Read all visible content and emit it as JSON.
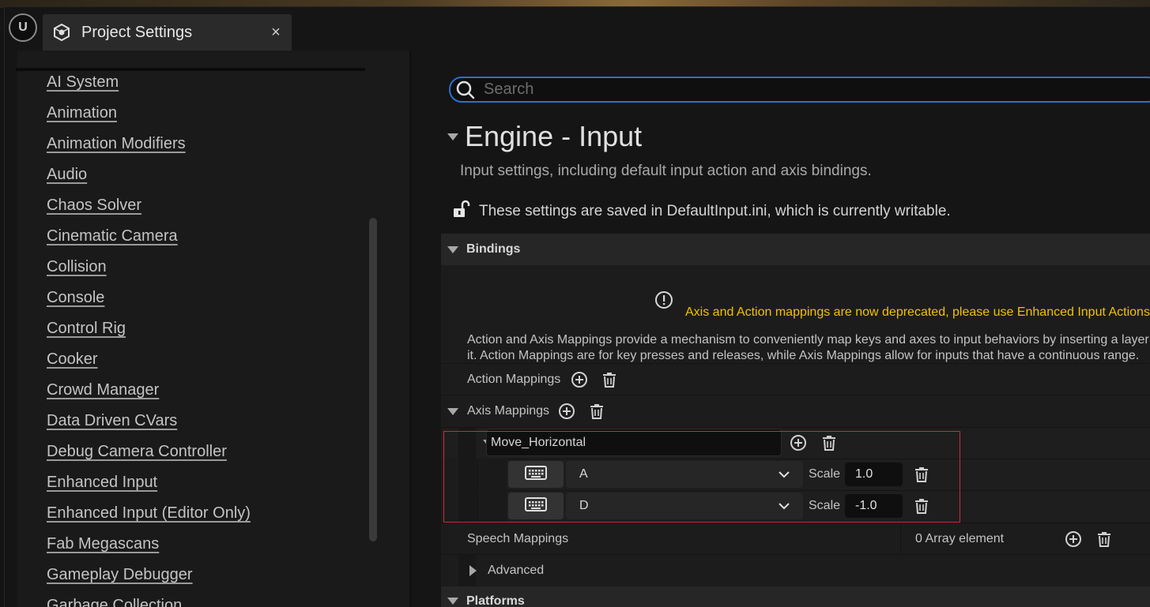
{
  "window": {
    "tab_title": "Project Settings",
    "close_glyph": "×",
    "logo_glyph": "U"
  },
  "sidebar": {
    "items": [
      {
        "label": "AI System"
      },
      {
        "label": "Animation"
      },
      {
        "label": "Animation Modifiers"
      },
      {
        "label": "Audio"
      },
      {
        "label": "Chaos Solver"
      },
      {
        "label": "Cinematic Camera"
      },
      {
        "label": "Collision"
      },
      {
        "label": "Console"
      },
      {
        "label": "Control Rig"
      },
      {
        "label": "Cooker"
      },
      {
        "label": "Crowd Manager"
      },
      {
        "label": "Data Driven CVars"
      },
      {
        "label": "Debug Camera Controller"
      },
      {
        "label": "Enhanced Input"
      },
      {
        "label": "Enhanced Input (Editor Only)"
      },
      {
        "label": "Fab Megascans"
      },
      {
        "label": "Gameplay Debugger"
      },
      {
        "label": "Garbage Collection"
      }
    ]
  },
  "search": {
    "placeholder": "Search",
    "value": ""
  },
  "page": {
    "title": "Engine - Input",
    "description": "Input settings, including default input action and axis bindings.",
    "writable_notice": "These settings are saved in DefaultInput.ini, which is currently writable."
  },
  "bindings": {
    "header": "Bindings",
    "deprecation_warning": "Axis and Action mappings are now deprecated, please use Enhanced Input Actions",
    "description_line1": "Action and Axis Mappings provide a mechanism to conveniently map keys and axes to input behaviors by inserting a layer",
    "description_line2": "it. Action Mappings are for key presses and releases, while Axis Mappings allow for inputs that have a continuous range.",
    "action_mappings_label": "Action Mappings",
    "axis_mappings_label": "Axis Mappings",
    "axis_mapping": {
      "name": "Move_Horizontal",
      "keys": [
        {
          "key": "A",
          "scale_label": "Scale",
          "scale": "1.0"
        },
        {
          "key": "D",
          "scale_label": "Scale",
          "scale": "-1.0"
        }
      ]
    },
    "speech_mappings_label": "Speech Mappings",
    "speech_mappings_value": "0 Array element",
    "advanced_label": "Advanced"
  },
  "platforms": {
    "header": "Platforms"
  },
  "colors": {
    "accent": "#2d6fcf",
    "warning": "#f2c200",
    "highlight_box": "#d0283a"
  }
}
